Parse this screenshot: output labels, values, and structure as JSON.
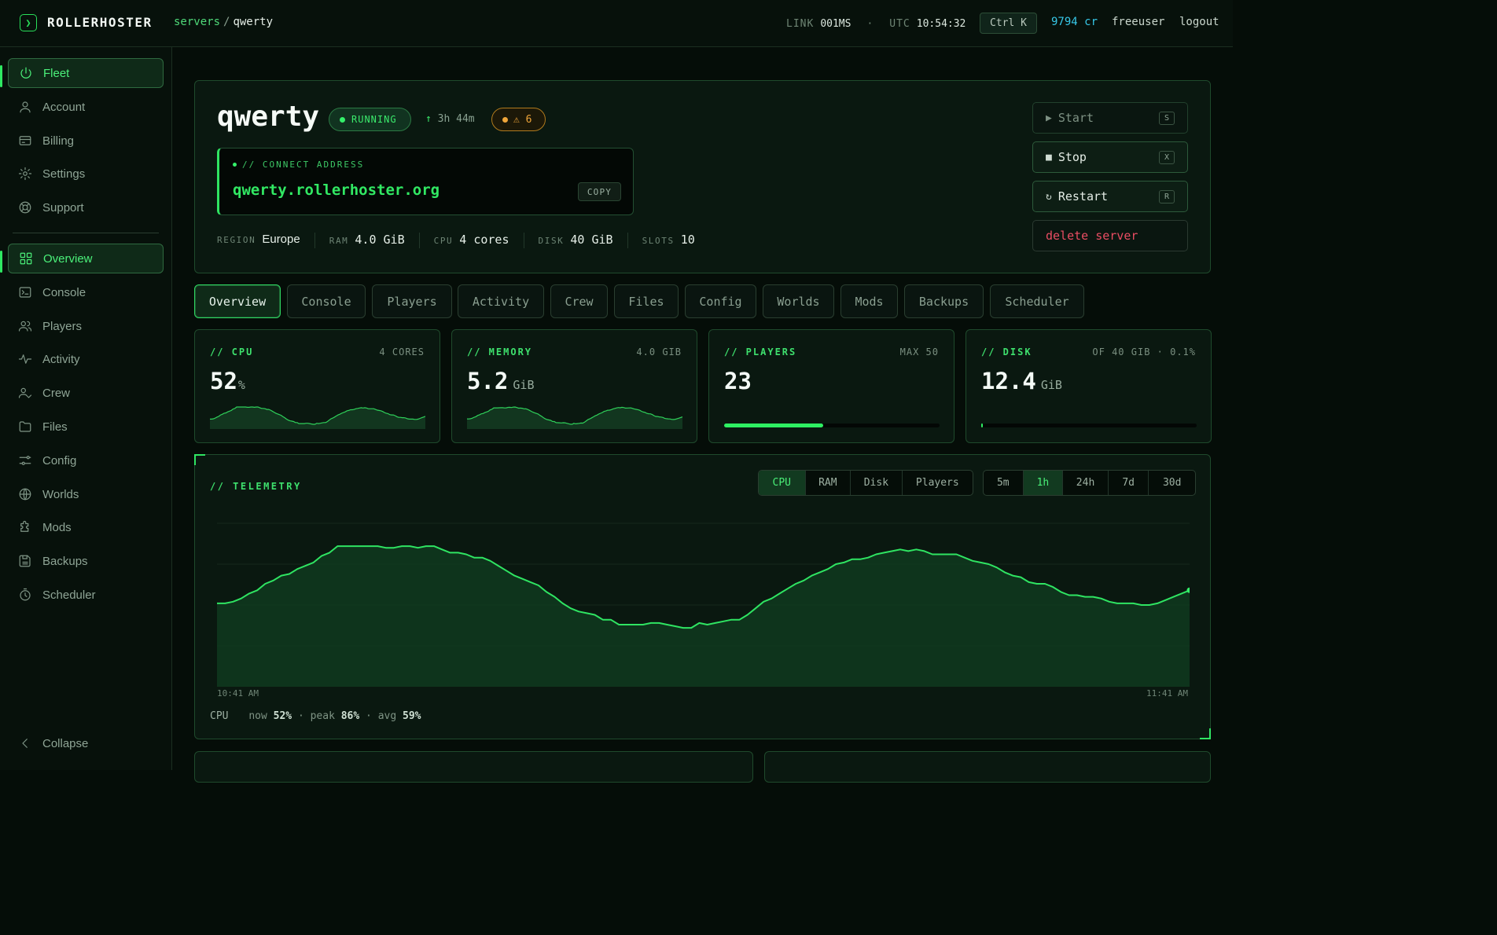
{
  "topbar": {
    "brand": "ROLLERHOSTER",
    "crumb_parent": "servers",
    "crumb_sep": "/",
    "crumb_current": "qwerty",
    "link_label": "LINK",
    "link_value": "001MS",
    "dot": "·",
    "utc_label": "UTC",
    "utc_value": "10:54:32",
    "shortcut": "Ctrl K",
    "credits": "9794 cr",
    "user": "freeuser",
    "logout": "logout"
  },
  "sidebar": {
    "top_items": [
      {
        "label": "Fleet",
        "icon": "power-icon"
      },
      {
        "label": "Account",
        "icon": "user-icon"
      },
      {
        "label": "Billing",
        "icon": "card-icon"
      },
      {
        "label": "Settings",
        "icon": "gear-icon"
      },
      {
        "label": "Support",
        "icon": "lifebuoy-icon"
      }
    ],
    "server_items": [
      {
        "label": "Overview",
        "icon": "grid-icon"
      },
      {
        "label": "Console",
        "icon": "terminal-icon"
      },
      {
        "label": "Players",
        "icon": "users-icon"
      },
      {
        "label": "Activity",
        "icon": "pulse-icon"
      },
      {
        "label": "Crew",
        "icon": "user-check-icon"
      },
      {
        "label": "Files",
        "icon": "folder-icon"
      },
      {
        "label": "Config",
        "icon": "sliders-icon"
      },
      {
        "label": "Worlds",
        "icon": "globe-icon"
      },
      {
        "label": "Mods",
        "icon": "puzzle-icon"
      },
      {
        "label": "Backups",
        "icon": "save-icon"
      },
      {
        "label": "Scheduler",
        "icon": "timer-icon"
      }
    ],
    "collapse": "Collapse"
  },
  "server": {
    "name": "qwerty",
    "status": "RUNNING",
    "uptime_arrow": "↑",
    "uptime": "3h 44m",
    "warnings": "⚠ 6",
    "connect_label": "// CONNECT ADDRESS",
    "connect_address": "qwerty.rollerhoster.org",
    "copy": "COPY",
    "specs": [
      {
        "k": "REGION",
        "v": "Europe"
      },
      {
        "k": "RAM",
        "v": "4.0 GiB"
      },
      {
        "k": "CPU",
        "v": "4 cores"
      },
      {
        "k": "DISK",
        "v": "40 GiB"
      },
      {
        "k": "SLOTS",
        "v": "10"
      }
    ]
  },
  "actions": {
    "start": {
      "sym": "▶",
      "label": "Start",
      "key": "S"
    },
    "stop": {
      "sym": "■",
      "label": "Stop",
      "key": "X"
    },
    "restart": {
      "sym": "↻",
      "label": "Restart",
      "key": "R"
    },
    "delete": "delete server"
  },
  "tabs": [
    "Overview",
    "Console",
    "Players",
    "Activity",
    "Crew",
    "Files",
    "Config",
    "Worlds",
    "Mods",
    "Backups",
    "Scheduler"
  ],
  "stats": {
    "cpu": {
      "title": "// CPU",
      "meta": "4 CORES",
      "value": "52",
      "unit": "%"
    },
    "memory": {
      "title": "// MEMORY",
      "meta": "4.0 GIB",
      "value": "5.2",
      "unit": "GiB"
    },
    "players": {
      "title": "// PLAYERS",
      "meta": "MAX 50",
      "value": "23",
      "fill_fraction": 0.46
    },
    "disk": {
      "title": "// DISK",
      "meta": "OF 40 GIB · 0.1%",
      "value": "12.4",
      "unit": "GiB",
      "fill_fraction": 0.003
    }
  },
  "telemetry": {
    "title": "// TELEMETRY",
    "metrics": [
      "CPU",
      "RAM",
      "Disk",
      "Players"
    ],
    "metric_active": "CPU",
    "ranges": [
      "5m",
      "1h",
      "24h",
      "7d",
      "30d"
    ],
    "range_active": "1h",
    "start_time": "10:41 AM",
    "end_time": "11:41 AM",
    "footer_metric": "CPU",
    "now_label": "now",
    "now": "52%",
    "peak_label": "· peak",
    "peak": "86%",
    "avg_label": "· avg",
    "avg": "59%"
  },
  "colors": {
    "accent": "#2fe462",
    "warn": "#f0a63a",
    "danger": "#ea4d63",
    "credits": "#37c8e8"
  },
  "chart_data": {
    "type": "area",
    "series": [
      {
        "name": "CPU",
        "values": [
          51,
          51,
          52,
          54,
          57,
          59,
          63,
          65,
          68,
          69,
          72,
          74,
          76,
          80,
          82,
          86,
          86,
          86,
          86,
          86,
          86,
          85,
          85,
          86,
          86,
          85,
          86,
          86,
          84,
          82,
          82,
          81,
          79,
          79,
          77,
          74,
          71,
          68,
          66,
          64,
          62,
          58,
          55,
          51,
          48,
          46,
          45,
          44,
          41,
          41,
          38,
          38,
          38,
          38,
          39,
          39,
          38,
          37,
          36,
          36,
          39,
          38,
          39,
          40,
          41,
          41,
          44,
          48,
          52,
          54,
          57,
          60,
          63,
          65,
          68,
          70,
          72,
          75,
          76,
          78,
          78,
          79,
          81,
          82,
          83,
          84,
          83,
          84,
          83,
          81,
          81,
          81,
          81,
          79,
          77,
          76,
          75,
          73,
          70,
          68,
          67,
          64,
          63,
          63,
          61,
          58,
          56,
          56,
          55,
          55,
          54,
          52,
          51,
          51,
          51,
          50,
          50,
          51,
          53,
          55,
          57,
          59
        ]
      }
    ],
    "ylim": [
      0,
      100
    ],
    "grid": true
  }
}
